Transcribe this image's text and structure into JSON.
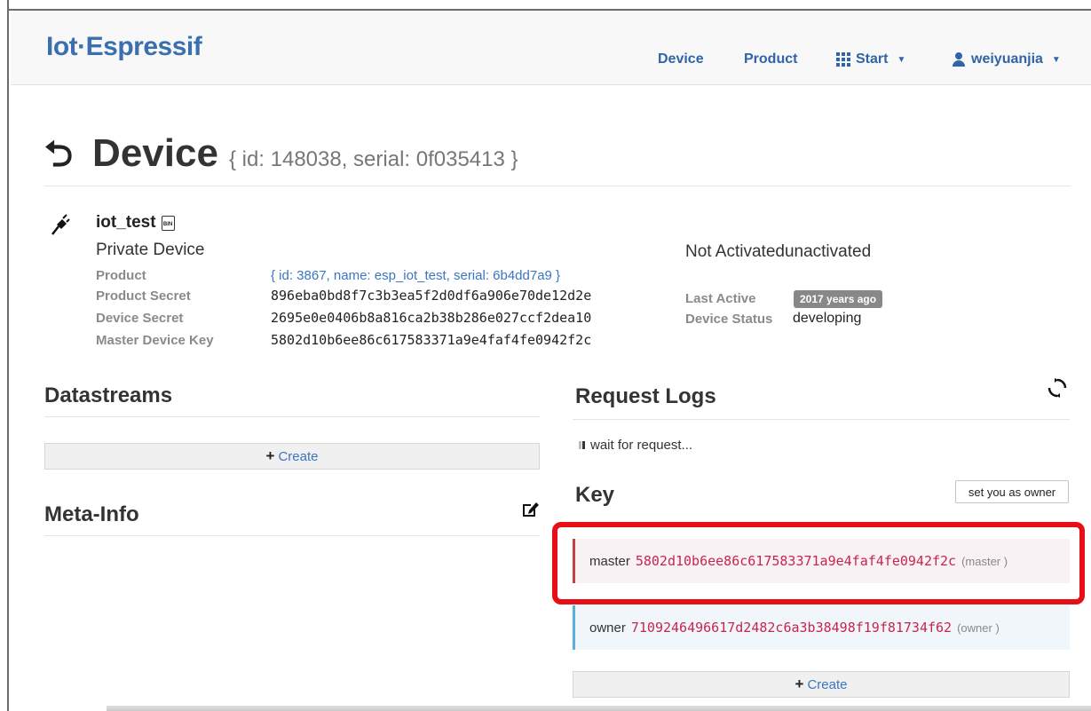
{
  "brand": "Iot·Espressif",
  "nav": {
    "device": "Device",
    "product": "Product",
    "start": "Start",
    "user": "weiyuanjia"
  },
  "header": {
    "title": "Device",
    "subtitle": "{ id: 148038, serial: 0f035413 }"
  },
  "device": {
    "name": "iot_test",
    "type": "Private Device",
    "info": [
      {
        "label": "Product",
        "value": "{ id: 3867, name: esp_iot_test, serial: 6b4dd7a9 }"
      },
      {
        "label": "Product Secret",
        "value": "896eba0bd8f7c3b3ea5f2d0df6a906e70de12d2e"
      },
      {
        "label": "Device Secret",
        "value": "2695e0e0406b8a816ca2b38b286e027ccf2dea10"
      },
      {
        "label": "Master Device Key",
        "value": "5802d10b6ee86c617583371a9e4faf4fe0942f2c"
      }
    ]
  },
  "status": {
    "title": "Not Activatedunactivated",
    "last_active_label": "Last Active",
    "last_active_value": "2017 years ago",
    "device_status_label": "Device Status",
    "device_status_value": "developing"
  },
  "datastreams": {
    "title": "Datastreams",
    "create_label": "Create"
  },
  "meta_info": {
    "title": "Meta-Info"
  },
  "request_logs": {
    "title": "Request Logs",
    "message": "wait for request..."
  },
  "keys": {
    "title": "Key",
    "owner_button": "set you as owner",
    "items": [
      {
        "label": "master",
        "code": "5802d10b6ee86c617583371a9e4faf4fe0942f2c",
        "role": "(master )"
      },
      {
        "label": "owner",
        "code": "7109246496617d2482c6a3b38498f19f81734f62",
        "role": "(owner )"
      }
    ],
    "create_label": "Create"
  },
  "colors": {
    "brand": "#3a6fb0",
    "link": "#3a76c2",
    "code": "#c7254e",
    "highlight": "#e80e16"
  }
}
